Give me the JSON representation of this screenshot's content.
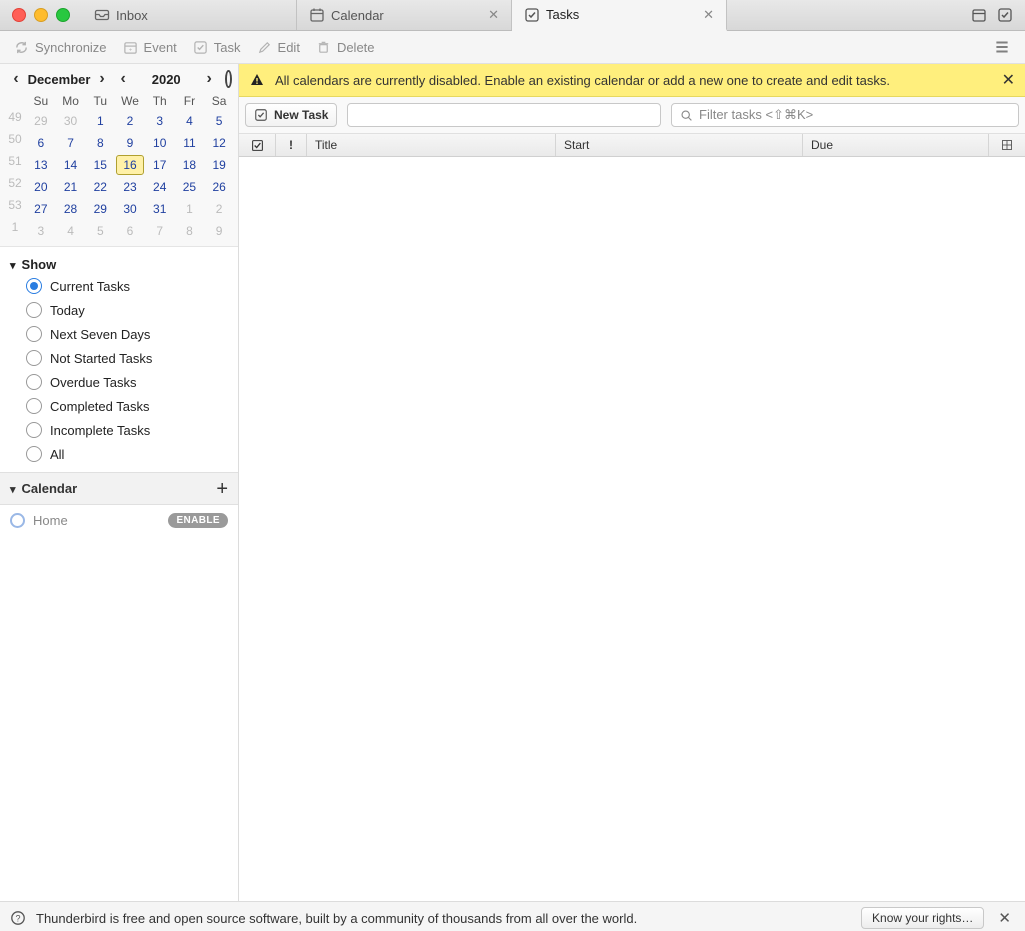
{
  "tabs": [
    {
      "label": "Inbox",
      "closable": false
    },
    {
      "label": "Calendar",
      "closable": true
    },
    {
      "label": "Tasks",
      "closable": true
    }
  ],
  "active_tab": 2,
  "toolbar": {
    "sync": "Synchronize",
    "event": "Event",
    "task": "Task",
    "edit": "Edit",
    "delete": "Delete"
  },
  "mini_month": {
    "month": "December",
    "year": "2020",
    "day_headers": [
      "Su",
      "Mo",
      "Tu",
      "We",
      "Th",
      "Fr",
      "Sa"
    ],
    "weeks": [
      {
        "wk": "49",
        "days": [
          {
            "n": "29",
            "o": true
          },
          {
            "n": "30",
            "o": true
          },
          {
            "n": "1"
          },
          {
            "n": "2"
          },
          {
            "n": "3"
          },
          {
            "n": "4"
          },
          {
            "n": "5"
          }
        ]
      },
      {
        "wk": "50",
        "days": [
          {
            "n": "6"
          },
          {
            "n": "7"
          },
          {
            "n": "8"
          },
          {
            "n": "9"
          },
          {
            "n": "10"
          },
          {
            "n": "11"
          },
          {
            "n": "12"
          }
        ]
      },
      {
        "wk": "51",
        "days": [
          {
            "n": "13"
          },
          {
            "n": "14"
          },
          {
            "n": "15"
          },
          {
            "n": "16",
            "t": true
          },
          {
            "n": "17"
          },
          {
            "n": "18"
          },
          {
            "n": "19"
          }
        ]
      },
      {
        "wk": "52",
        "days": [
          {
            "n": "20"
          },
          {
            "n": "21"
          },
          {
            "n": "22"
          },
          {
            "n": "23"
          },
          {
            "n": "24"
          },
          {
            "n": "25"
          },
          {
            "n": "26"
          }
        ]
      },
      {
        "wk": "53",
        "days": [
          {
            "n": "27"
          },
          {
            "n": "28"
          },
          {
            "n": "29"
          },
          {
            "n": "30"
          },
          {
            "n": "31"
          },
          {
            "n": "1",
            "o": true
          },
          {
            "n": "2",
            "o": true
          }
        ]
      },
      {
        "wk": "1",
        "days": [
          {
            "n": "3",
            "o": true
          },
          {
            "n": "4",
            "o": true
          },
          {
            "n": "5",
            "o": true
          },
          {
            "n": "6",
            "o": true
          },
          {
            "n": "7",
            "o": true
          },
          {
            "n": "8",
            "o": true
          },
          {
            "n": "9",
            "o": true
          }
        ]
      }
    ]
  },
  "show": {
    "heading": "Show",
    "options": [
      "Current Tasks",
      "Today",
      "Next Seven Days",
      "Not Started Tasks",
      "Overdue Tasks",
      "Completed Tasks",
      "Incomplete Tasks",
      "All"
    ],
    "selected": 0
  },
  "calendar_section": {
    "heading": "Calendar",
    "item": "Home",
    "badge": "ENABLE"
  },
  "warning": "All calendars are currently disabled. Enable an existing calendar or add a new one to create and edit tasks.",
  "taskbar": {
    "new_task": "New Task",
    "filter_placeholder": "Filter tasks <⇧⌘K>"
  },
  "columns": {
    "title": "Title",
    "start": "Start",
    "due": "Due"
  },
  "status": {
    "text": "Thunderbird is free and open source software, built by a community of thousands from all over the world.",
    "rights": "Know your rights…"
  }
}
